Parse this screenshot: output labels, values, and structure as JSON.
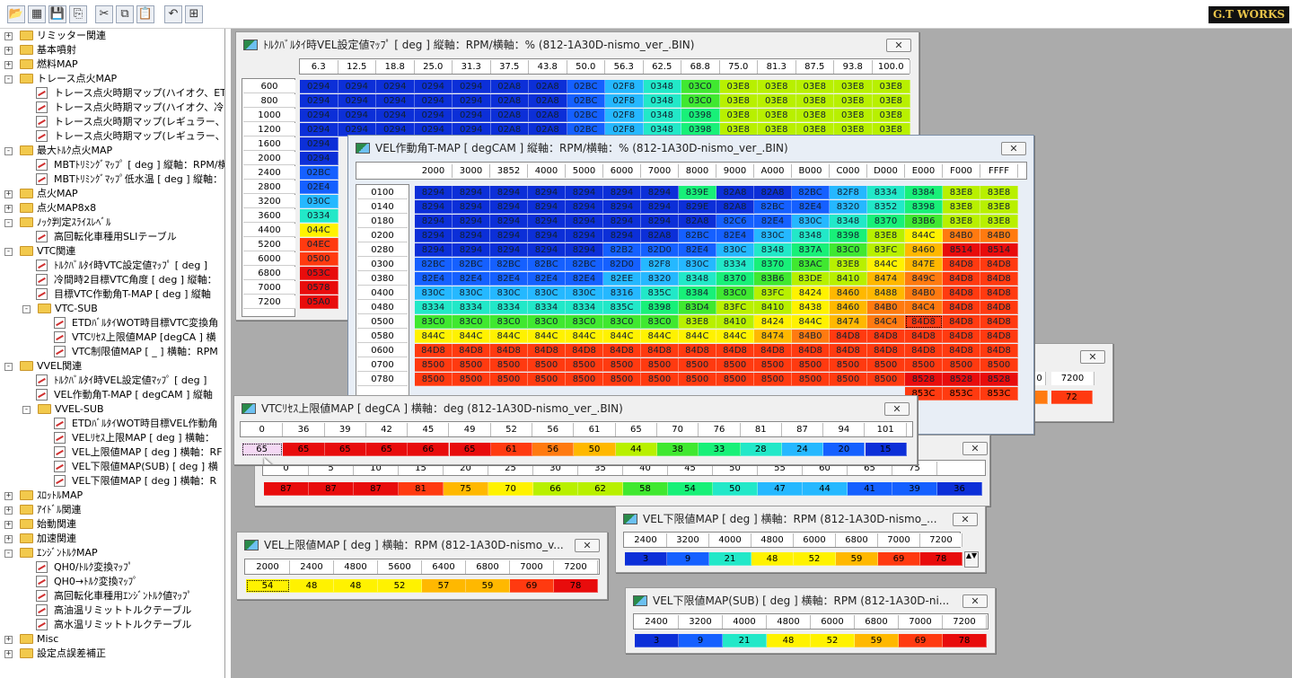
{
  "brand": {
    "logo_text": "G.T WORKS"
  },
  "toolbar": {
    "buttons": [
      {
        "name": "open-folder-icon",
        "glyph": "📂"
      },
      {
        "name": "table-icon",
        "glyph": "▦"
      },
      {
        "name": "save-icon",
        "glyph": "💾"
      },
      {
        "name": "save-as-icon",
        "glyph": "⎘"
      },
      {
        "name": "cut-icon",
        "glyph": "✂"
      },
      {
        "name": "copy-icon",
        "glyph": "⧉"
      },
      {
        "name": "paste-icon",
        "glyph": "📋"
      },
      {
        "name": "undo-icon",
        "glyph": "↶"
      },
      {
        "name": "compare-icon",
        "glyph": "⊞"
      }
    ]
  },
  "tree": {
    "items": [
      {
        "t": "リミッター関連",
        "lv": 0,
        "k": "f",
        "e": "+"
      },
      {
        "t": "基本噴射",
        "lv": 0,
        "k": "f",
        "e": "+"
      },
      {
        "t": "燃料MAP",
        "lv": 0,
        "k": "f",
        "e": "+"
      },
      {
        "t": "トレース点火MAP",
        "lv": 0,
        "k": "f",
        "e": "-"
      },
      {
        "t": "トレース点火時期マップ(ハイオク、ET",
        "lv": 1,
        "k": "d"
      },
      {
        "t": "トレース点火時期マップ(ハイオク、冷",
        "lv": 1,
        "k": "d"
      },
      {
        "t": "トレース点火時期マップ(レギュラー、E",
        "lv": 1,
        "k": "d"
      },
      {
        "t": "トレース点火時期マップ(レギュラー、ﾒ",
        "lv": 1,
        "k": "d"
      },
      {
        "t": "最大ﾄﾙｸ点火MAP",
        "lv": 0,
        "k": "f",
        "e": "-"
      },
      {
        "t": "MBTﾄﾘﾐﾝｸﾞﾏｯﾌﾟ [ deg ] 縦軸：RPM/横",
        "lv": 1,
        "k": "d"
      },
      {
        "t": "MBTﾄﾘﾐﾝｸﾞﾏｯﾌﾟ低水温 [ deg ] 縦軸：",
        "lv": 1,
        "k": "d"
      },
      {
        "t": "点火MAP",
        "lv": 0,
        "k": "f",
        "e": "+"
      },
      {
        "t": "点火MAP8x8",
        "lv": 0,
        "k": "f",
        "e": "+"
      },
      {
        "t": "ﾉｯｸ判定ｽﾗｲｽﾚﾍﾞﾙ",
        "lv": 0,
        "k": "f",
        "e": "-"
      },
      {
        "t": "高回転化車種用SLIテーブル",
        "lv": 1,
        "k": "d"
      },
      {
        "t": "VTC関連",
        "lv": 0,
        "k": "f",
        "e": "-"
      },
      {
        "t": "ﾄﾙｸﾊﾞﾙﾀｲ時VTC設定値ﾏｯﾌﾟ [ deg ]",
        "lv": 1,
        "k": "d"
      },
      {
        "t": "冷間時2目標VTC角度 [ deg ] 縦軸：",
        "lv": 1,
        "k": "d"
      },
      {
        "t": "目標VTC作動角T-MAP [ deg ] 縦軸",
        "lv": 1,
        "k": "d"
      },
      {
        "t": "VTC-SUB",
        "lv": 1,
        "k": "f",
        "e": "-"
      },
      {
        "t": "ETDﾊﾞﾙﾀｲWOT時目標VTC変換角",
        "lv": 2,
        "k": "d"
      },
      {
        "t": "VTCﾘｾｽ上限値MAP [degCA ] 横",
        "lv": 2,
        "k": "d"
      },
      {
        "t": "VTC制限値MAP [ _ ] 横軸：RPM",
        "lv": 2,
        "k": "d"
      },
      {
        "t": "VVEL関連",
        "lv": 0,
        "k": "f",
        "e": "-"
      },
      {
        "t": "ﾄﾙｸﾊﾞﾙﾀｲ時VEL設定値ﾏｯﾌﾟ [ deg ]",
        "lv": 1,
        "k": "d"
      },
      {
        "t": "VEL作動角T-MAP [ degCAM ] 縦軸",
        "lv": 1,
        "k": "d"
      },
      {
        "t": "VVEL-SUB",
        "lv": 1,
        "k": "f",
        "e": "-"
      },
      {
        "t": "ETDﾊﾞﾙﾀｲWOT時目標VEL作動角",
        "lv": 2,
        "k": "d"
      },
      {
        "t": "VELﾘｾｽ上限MAP [ deg ] 横軸：",
        "lv": 2,
        "k": "d"
      },
      {
        "t": "VEL上限値MAP [ deg ] 横軸：RF",
        "lv": 2,
        "k": "d"
      },
      {
        "t": "VEL下限値MAP(SUB) [ deg ] 横",
        "lv": 2,
        "k": "d"
      },
      {
        "t": "VEL下限値MAP [ deg ] 横軸：R",
        "lv": 2,
        "k": "d"
      },
      {
        "t": "ｽﾛｯﾄﾙMAP",
        "lv": 0,
        "k": "f",
        "e": "+"
      },
      {
        "t": "ｱｲﾄﾞﾙ関連",
        "lv": 0,
        "k": "f",
        "e": "+"
      },
      {
        "t": "始動関連",
        "lv": 0,
        "k": "f",
        "e": "+"
      },
      {
        "t": "加速関連",
        "lv": 0,
        "k": "f",
        "e": "+"
      },
      {
        "t": "ｴﾝｼﾞﾝﾄﾙｸMAP",
        "lv": 0,
        "k": "f",
        "e": "-"
      },
      {
        "t": "QH0/ﾄﾙｸ変換ﾏｯﾌﾟ",
        "lv": 1,
        "k": "d"
      },
      {
        "t": "QH0→ﾄﾙｸ変換ﾏｯﾌﾟ",
        "lv": 1,
        "k": "d"
      },
      {
        "t": "高回転化車種用ｴﾝｼﾞﾝﾄﾙｸ値ﾏｯﾌﾟ",
        "lv": 1,
        "k": "d"
      },
      {
        "t": "高油温リミットトルクテーブル",
        "lv": 1,
        "k": "d"
      },
      {
        "t": "高水温リミットトルクテーブル",
        "lv": 1,
        "k": "d"
      },
      {
        "t": "Misc",
        "lv": 0,
        "k": "f",
        "e": "+"
      },
      {
        "t": "設定点誤差補正",
        "lv": 0,
        "k": "f",
        "e": "+"
      }
    ]
  },
  "colors": {
    "c1": "#0c2fd8",
    "c2": "#1560ff",
    "c3": "#25b8ff",
    "c4": "#22e8c8",
    "c5": "#18f078",
    "c6": "#40e830",
    "c7": "#b8f000",
    "c8": "#fff200",
    "c9": "#ffb800",
    "c10": "#ff7a10",
    "c11": "#ff3a10",
    "c12": "#e80c0c"
  },
  "windows": {
    "w1": {
      "title": "ﾄﾙｸﾊﾞﾙﾀｲ時VEL設定値ﾏｯﾌﾟ [ deg ]  縦軸：RPM/横軸：% (812-1A30D-nismo_ver_.BIN)",
      "cols": [
        "6.3",
        "12.5",
        "18.8",
        "25.0",
        "31.3",
        "37.5",
        "43.8",
        "50.0",
        "56.3",
        "62.5",
        "68.8",
        "75.0",
        "81.3",
        "87.5",
        "93.8",
        "100.0"
      ],
      "rows": [
        "600",
        "800",
        "1000",
        "1200",
        "1600",
        "2000",
        "2400",
        "2800",
        "3200",
        "3600",
        "4400",
        "5200",
        "6000",
        "6800",
        "7000",
        "7200"
      ],
      "cells": [
        [
          "0294",
          "0294",
          "0294",
          "0294",
          "0294",
          "02A8",
          "02A8",
          "02BC",
          "02F8",
          "0348",
          "03C0",
          "03E8",
          "03E8",
          "03E8",
          "03E8",
          "03E8"
        ],
        [
          "0294",
          "0294",
          "0294",
          "0294",
          "0294",
          "02A8",
          "02A8",
          "02BC",
          "02F8",
          "0348",
          "03C0",
          "03E8",
          "03E8",
          "03E8",
          "03E8",
          "03E8"
        ],
        [
          "0294",
          "0294",
          "0294",
          "0294",
          "0294",
          "02A8",
          "02A8",
          "02BC",
          "02F8",
          "0348",
          "0398",
          "03E8",
          "03E8",
          "03E8",
          "03E8",
          "03E8"
        ],
        [
          "0294",
          "0294",
          "0294",
          "0294",
          "0294",
          "02A8",
          "02A8",
          "02BC",
          "02F8",
          "0348",
          "0398",
          "03E8",
          "03E8",
          "03E8",
          "03E8",
          "03E8"
        ],
        [
          "0294"
        ],
        [
          "0294"
        ],
        [
          "02BC"
        ],
        [
          "02E4"
        ],
        [
          "030C"
        ],
        [
          "0334"
        ],
        [
          "044C"
        ],
        [
          "04EC"
        ],
        [
          "0500"
        ],
        [
          "053C"
        ],
        [
          "0578"
        ],
        [
          "05A0"
        ]
      ]
    },
    "w2": {
      "title": "VEL作動角T-MAP [ degCAM ]  縦軸：RPM/横軸：% (812-1A30D-nismo_ver_.BIN)",
      "cols": [
        "2000",
        "3000",
        "3852",
        "4000",
        "5000",
        "6000",
        "7000",
        "8000",
        "9000",
        "A000",
        "B000",
        "C000",
        "D000",
        "E000",
        "F000",
        "FFFF"
      ],
      "rows": [
        "0100",
        "0140",
        "0180",
        "0200",
        "0280",
        "0300",
        "0380",
        "0400",
        "0480",
        "0500",
        "0580",
        "0600",
        "0700",
        "0780"
      ],
      "cells": [
        [
          "8294",
          "8294",
          "8294",
          "8294",
          "8294",
          "8294",
          "8294",
          "839E",
          "82A8",
          "82A8",
          "82BC",
          "82F8",
          "8334",
          "8384",
          "83E8",
          "83E8"
        ],
        [
          "8294",
          "8294",
          "8294",
          "8294",
          "8294",
          "8294",
          "8294",
          "829E",
          "82A8",
          "82BC",
          "82E4",
          "8320",
          "8352",
          "8398",
          "83E8",
          "83E8"
        ],
        [
          "8294",
          "8294",
          "8294",
          "8294",
          "8294",
          "8294",
          "8294",
          "82A8",
          "82C6",
          "82E4",
          "830C",
          "8348",
          "8370",
          "83B6",
          "83E8",
          "83E8"
        ],
        [
          "8294",
          "8294",
          "8294",
          "8294",
          "8294",
          "8294",
          "82A8",
          "82BC",
          "82E4",
          "830C",
          "8348",
          "8398",
          "83E8",
          "844C",
          "84B0",
          "84B0"
        ],
        [
          "8294",
          "8294",
          "8294",
          "8294",
          "8294",
          "82B2",
          "82D0",
          "82E4",
          "830C",
          "8348",
          "837A",
          "83C0",
          "83FC",
          "8460",
          "8514",
          "8514"
        ],
        [
          "82BC",
          "82BC",
          "82BC",
          "82BC",
          "82BC",
          "82D0",
          "82F8",
          "830C",
          "8334",
          "8370",
          "83AC",
          "83E8",
          "844C",
          "847E",
          "84D8",
          "84D8"
        ],
        [
          "82E4",
          "82E4",
          "82E4",
          "82E4",
          "82E4",
          "82EE",
          "8320",
          "8348",
          "8370",
          "83B6",
          "83DE",
          "8410",
          "8474",
          "849C",
          "84D8",
          "84D8"
        ],
        [
          "830C",
          "830C",
          "830C",
          "830C",
          "830C",
          "8316",
          "835C",
          "8384",
          "83C0",
          "83FC",
          "8424",
          "8460",
          "8488",
          "84B0",
          "84D8",
          "84D8"
        ],
        [
          "8334",
          "8334",
          "8334",
          "8334",
          "8334",
          "835C",
          "8398",
          "83D4",
          "83FC",
          "8410",
          "8438",
          "8460",
          "84B0",
          "84C4",
          "84D8",
          "84D8"
        ],
        [
          "83C0",
          "83C0",
          "83C0",
          "83C0",
          "83C0",
          "83C0",
          "83C0",
          "83E8",
          "8410",
          "8424",
          "844C",
          "8474",
          "84C4",
          "84D8",
          "84D8",
          "84D8"
        ],
        [
          "844C",
          "844C",
          "844C",
          "844C",
          "844C",
          "844C",
          "844C",
          "844C",
          "844C",
          "8474",
          "84B0",
          "84D8",
          "84D8",
          "84D8",
          "84D8",
          "84D8"
        ],
        [
          "84D8",
          "84D8",
          "84D8",
          "84D8",
          "84D8",
          "84D8",
          "84D8",
          "84D8",
          "84D8",
          "84D8",
          "84D8",
          "84D8",
          "84D8",
          "84D8",
          "84D8",
          "84D8"
        ],
        [
          "8500",
          "8500",
          "8500",
          "8500",
          "8500",
          "8500",
          "8500",
          "8500",
          "8500",
          "8500",
          "8500",
          "8500",
          "8500",
          "8500",
          "8500",
          "8500"
        ],
        [
          "8500",
          "8500",
          "8500",
          "8500",
          "8500",
          "8500",
          "8500",
          "8500",
          "8500",
          "8500",
          "8500",
          "8500",
          "8500",
          "8528",
          "8528",
          "8528"
        ]
      ],
      "partial_tail": [
        "853C",
        "853C",
        "853C"
      ]
    },
    "w3": {
      "title": "VTCﾘｾｽ上限値MAP [ degCA ] 横軸：deg (812-1A30D-nismo_ver_.BIN)",
      "cols": [
        "0",
        "36",
        "39",
        "42",
        "45",
        "49",
        "52",
        "56",
        "61",
        "65",
        "70",
        "76",
        "81",
        "87",
        "94",
        "101"
      ],
      "vals": [
        "65",
        "65",
        "65",
        "65",
        "66",
        "65",
        "61",
        "56",
        "50",
        "44",
        "38",
        "33",
        "28",
        "24",
        "20",
        "15"
      ]
    },
    "w4": {
      "cols": [
        "0",
        "5",
        "10",
        "15",
        "20",
        "25",
        "30",
        "35",
        "40",
        "45",
        "50",
        "55",
        "60",
        "65",
        "75"
      ],
      "vals": [
        "87",
        "87",
        "87",
        "81",
        "75",
        "70",
        "66",
        "62",
        "58",
        "54",
        "50",
        "47",
        "44",
        "41",
        "39",
        "36"
      ]
    },
    "w5": {
      "title": "VEL上限値MAP [ deg ]  横軸：RPM (812-1A30D-nismo_v...",
      "cols": [
        "2000",
        "2400",
        "4800",
        "5600",
        "6400",
        "6800",
        "7000",
        "7200"
      ],
      "vals": [
        "54",
        "48",
        "48",
        "52",
        "57",
        "59",
        "69",
        "78"
      ]
    },
    "w6": {
      "title": "VEL下限値MAP [ deg ]  横軸：RPM (812-1A30D-nismo_...",
      "cols": [
        "2400",
        "3200",
        "4000",
        "4800",
        "6000",
        "6800",
        "7000",
        "7200"
      ],
      "vals": [
        "3",
        "9",
        "21",
        "48",
        "52",
        "59",
        "69",
        "78"
      ]
    },
    "w7": {
      "title": "VEL下限値MAP(SUB) [ deg ]  横軸：RPM (812-1A30D-ni...",
      "cols": [
        "2400",
        "3200",
        "4000",
        "4800",
        "6000",
        "6800",
        "7000",
        "7200"
      ],
      "vals": [
        "3",
        "9",
        "21",
        "48",
        "52",
        "59",
        "69",
        "78"
      ]
    },
    "w8": {
      "cols": [
        "0",
        "7200"
      ],
      "vals": [
        "72"
      ]
    }
  }
}
